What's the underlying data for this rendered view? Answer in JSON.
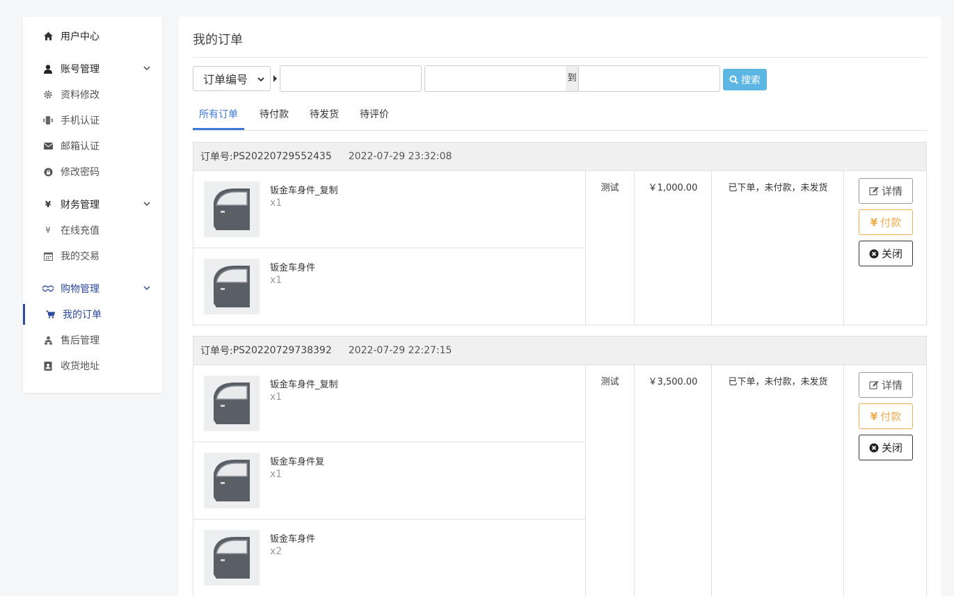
{
  "sidebar": {
    "home": "用户中心",
    "account": {
      "label": "账号管理",
      "items": [
        "资料修改",
        "手机认证",
        "邮箱认证",
        "修改密码"
      ]
    },
    "finance": {
      "label": "财务管理",
      "items": [
        "在线充值",
        "我的交易"
      ]
    },
    "shopping": {
      "label": "购物管理",
      "items": [
        "我的订单",
        "售后管理",
        "收货地址"
      ],
      "active": "我的订单"
    },
    "accent": "#2d4a9c"
  },
  "main": {
    "title": "我的订单",
    "search": {
      "field_select": "订单编号",
      "range_to": "到",
      "button": "搜索"
    },
    "tabs": [
      {
        "label": "所有订单",
        "active": true
      },
      {
        "label": "待付款",
        "active": false
      },
      {
        "label": "待发货",
        "active": false
      },
      {
        "label": "待评价",
        "active": false
      }
    ]
  },
  "orders": [
    {
      "label": "订单号:",
      "number": "PS20220729552435",
      "time": "2022-07-29 23:32:08",
      "remark": "测试",
      "price": "￥1,000.00",
      "status": "已下单，未付款，未发货",
      "items": [
        {
          "name": "钣金车身件_复制",
          "qty": "x1"
        },
        {
          "name": "钣金车身件",
          "qty": "x1"
        }
      ]
    },
    {
      "label": "订单号:",
      "number": "PS20220729738392",
      "time": "2022-07-29 22:27:15",
      "remark": "测试",
      "price": "￥3,500.00",
      "status": "已下单，未付款，未发货",
      "items": [
        {
          "name": "钣金车身件_复制",
          "qty": "x1"
        },
        {
          "name": "钣金车身件复",
          "qty": "x1"
        },
        {
          "name": "钣金车身件",
          "qty": "x2"
        }
      ]
    }
  ],
  "actions": {
    "detail": "详情",
    "pay": "付款",
    "close": "关闭"
  },
  "colors": {
    "search_button": "#5bb6e4",
    "tab_active": "#3b78d8",
    "pay": "#f0ad4e"
  }
}
